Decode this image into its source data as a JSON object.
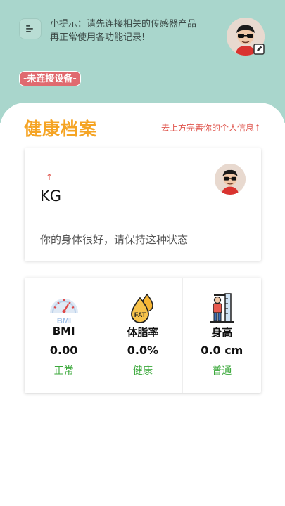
{
  "header": {
    "tip_line1": "小提示：请先连接相关的传感器产品",
    "tip_line2": "再正常使用各功能记录!",
    "device_status": "-未连接设备-"
  },
  "profile": {
    "title": "健康档案",
    "complete_hint": "去上方完善你的个人信息↑",
    "arrow": "↑",
    "unit": "KG",
    "status_message": "你的身体很好，请保持这种状态"
  },
  "metrics": [
    {
      "name": "BMI",
      "value": "0.00",
      "state": "正常",
      "icon": "bmi-gauge-icon",
      "icon_text": "BMI"
    },
    {
      "name": "体脂率",
      "value": "0.0%",
      "state": "健康",
      "icon": "fat-drop-icon",
      "icon_text": "FAT"
    },
    {
      "name": "身高",
      "value": "0.0 cm",
      "state": "普通",
      "icon": "height-ruler-icon"
    }
  ],
  "colors": {
    "header_bg": "#a9d6cc",
    "title_orange": "#f5a424",
    "warning_red": "#e06a6f",
    "good_green": "#3aa83a"
  }
}
